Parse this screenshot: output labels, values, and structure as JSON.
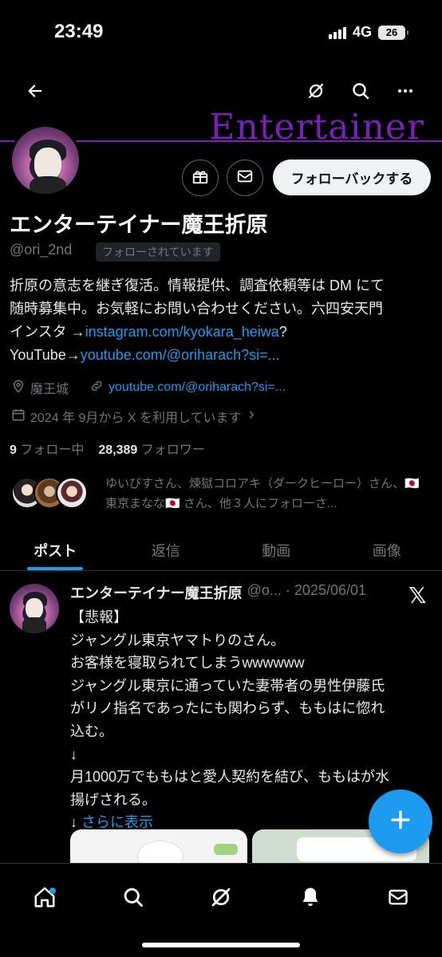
{
  "status": {
    "time": "23:49",
    "network": "4G",
    "battery": "26"
  },
  "header": {
    "banner_text": "Entertainer"
  },
  "profile": {
    "followback_label": "フォローバックする",
    "name": "エンターテイナー魔王折原",
    "handle": "@ori_2nd",
    "follows_you": "フォローされています",
    "bio_line1": "折原の意志を継ぎ復活。情報提供、調査依頼等は DM にて",
    "bio_line2": "随時募集中。お気軽にお問い合わせください。六四安天門",
    "bio_line3_prefix": "インスタ →",
    "bio_line3_link": "instagram.com/kyokara_heiwa",
    "bio_line3_suffix": "?",
    "bio_line4_prefix": "YouTube→",
    "bio_line4_link": "youtube.com/@oriharach?si=...",
    "location": "魔王城",
    "website": "youtube.com/@oriharach?si=...",
    "joined": "2024 年 9月から X を利用しています",
    "following_count": "9",
    "following_label": "フォロー中",
    "followers_count": "28,389",
    "followers_label": "フォロワー",
    "followed_by": "ゆいぴすさん、煉獄コロアキ（ダークヒーロー）さん、🇯🇵 東京まなな🇯🇵 さん、他３人にフォローさ..."
  },
  "tabs": [
    {
      "label": "ポスト",
      "active": true
    },
    {
      "label": "返信",
      "active": false
    },
    {
      "label": "動画",
      "active": false
    },
    {
      "label": "画像",
      "active": false
    }
  ],
  "post": {
    "name": "エンターテイナー魔王折原",
    "handle_date": "@o... · 2025/06/01",
    "lines": [
      "【悲報】",
      "ジャングル東京ヤマトりのさん。",
      "お客様を寝取られてしまうwwwwww",
      "ジャングル東京に通っていた妻帯者の男性伊藤氏",
      "がリノ指名であったにも関わらず、ももはに惚れ",
      "込む。",
      "↓",
      "月1000万でももはと愛人契約を結び、ももはが水",
      "揚げされる。"
    ],
    "more_prefix": "↓ ",
    "more_link": "さらに表示"
  },
  "colors": {
    "accent": "#1d9bf0",
    "banner": "#7b1fb8",
    "muted": "#71767b"
  },
  "icons": [
    "back-arrow-icon",
    "grok-icon",
    "search-icon",
    "more-icon",
    "gift-icon",
    "mail-icon",
    "location-icon",
    "link-icon",
    "calendar-icon",
    "home-icon",
    "bell-icon",
    "compose-icon"
  ]
}
